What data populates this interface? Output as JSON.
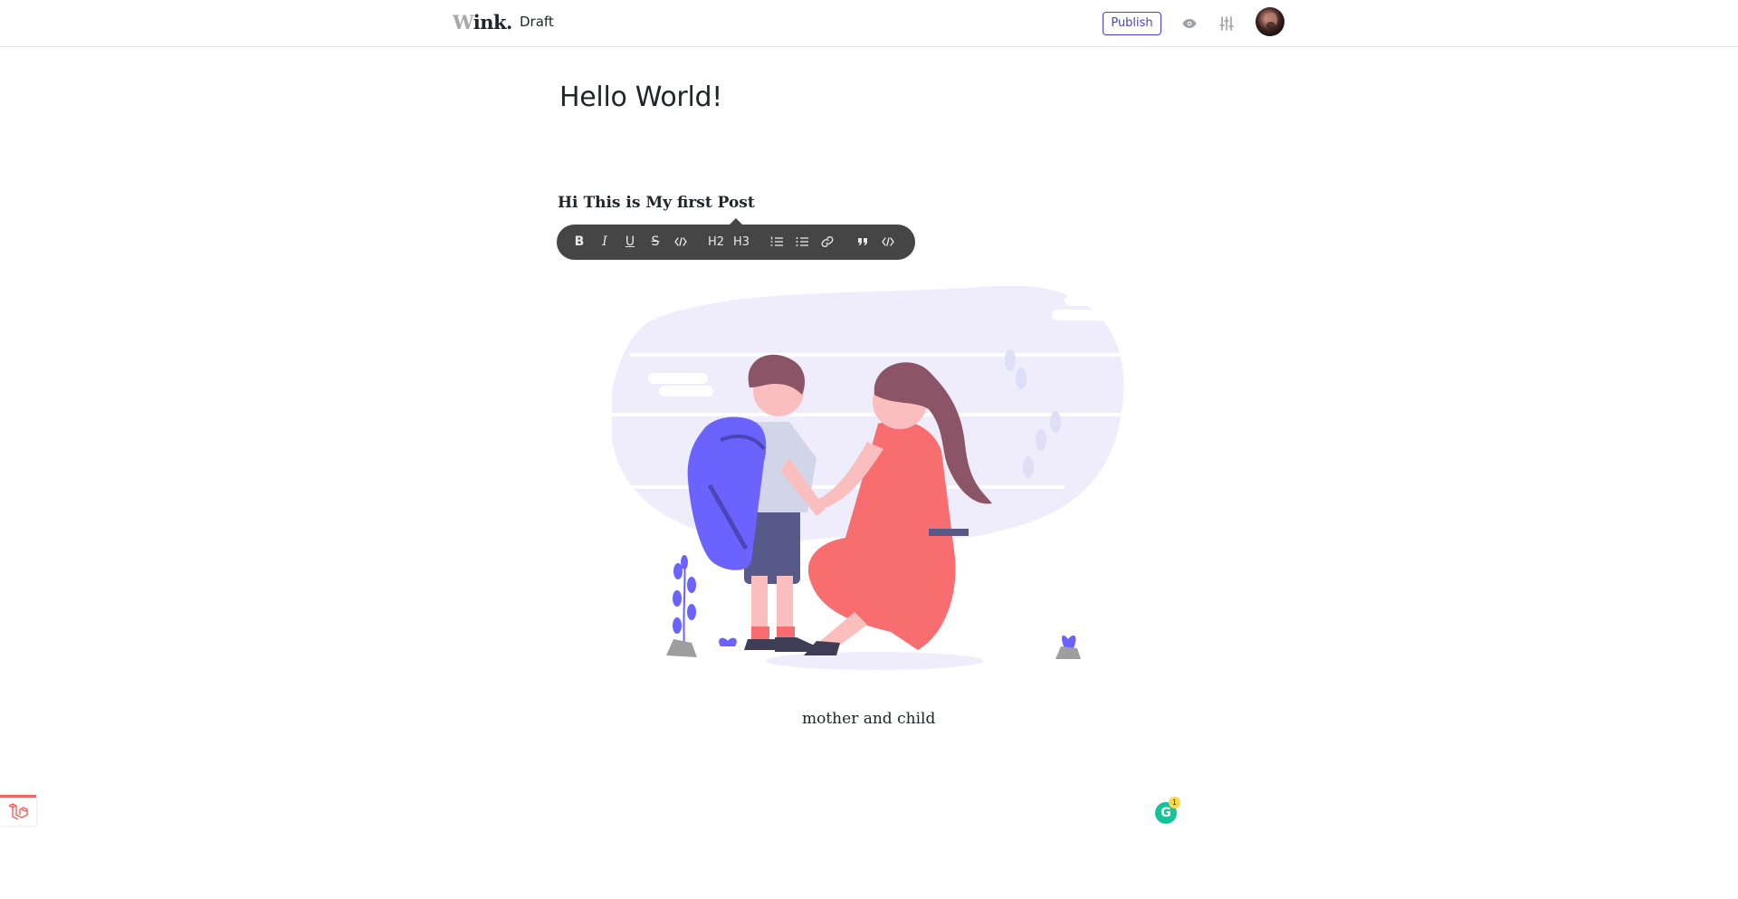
{
  "header": {
    "brand_first": "W",
    "brand_rest": "ink.",
    "status": "Draft",
    "publish_label": "Publish",
    "preview_icon": "eye-icon",
    "settings_icon": "sliders-icon",
    "avatar": "user-avatar"
  },
  "editor": {
    "title": "Hello World!",
    "body_text": "Hi This is My first Post",
    "image_alt": "mother and child",
    "caption": "mother and child"
  },
  "toolbar": {
    "bold": "B",
    "italic": "I",
    "underline": "U",
    "strike": "S",
    "h2": "H2",
    "h3": "H3"
  },
  "widgets": {
    "grammarly_count": "1",
    "grammarly_letter": "G"
  },
  "colors": {
    "accent": "#4c3fd0",
    "toolbar_bg": "#454545",
    "grammarly": "#15c39a",
    "laravel": "#f4645f"
  }
}
